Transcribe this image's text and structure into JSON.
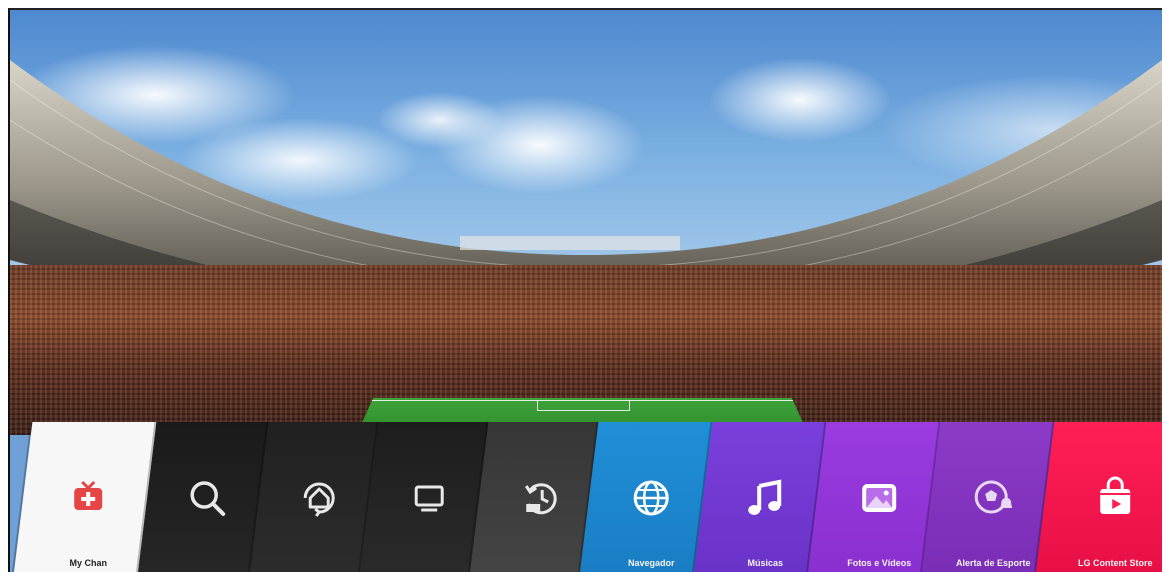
{
  "background": {
    "scene": "stadium-background",
    "colors": {
      "sky": "#5b93d3",
      "crowd": "#7a3f28",
      "pitch": "#35992f"
    }
  },
  "launcher": {
    "tiles": [
      {
        "id": "my-channel",
        "label": "My Chan",
        "icon": "tv-plus-icon",
        "color": "#f7f7f7"
      },
      {
        "id": "search",
        "label": "",
        "icon": "search-icon",
        "color": "#1f1f1f"
      },
      {
        "id": "home",
        "label": "",
        "icon": "home-icon",
        "color": "#262626"
      },
      {
        "id": "input",
        "label": "",
        "icon": "tv-input-icon",
        "color": "#222222"
      },
      {
        "id": "recent",
        "label": "",
        "icon": "history-icon",
        "color": "#3c3c3c"
      },
      {
        "id": "browser",
        "label": "Navegador",
        "icon": "globe-icon",
        "color": "#1f8fd8"
      },
      {
        "id": "music",
        "label": "Músicas",
        "icon": "music-note-icon",
        "color": "#7a3fdc"
      },
      {
        "id": "photos",
        "label": "Fotos e Vídeos",
        "icon": "image-icon",
        "color": "#9a3ce0"
      },
      {
        "id": "sports",
        "label": "Alerta de Esporte",
        "icon": "soccer-ball-bell-icon",
        "color": "#8c3bc9"
      },
      {
        "id": "store",
        "label": "LG Content Store",
        "icon": "store-bag-icon",
        "color": "#ff1f55"
      }
    ]
  }
}
